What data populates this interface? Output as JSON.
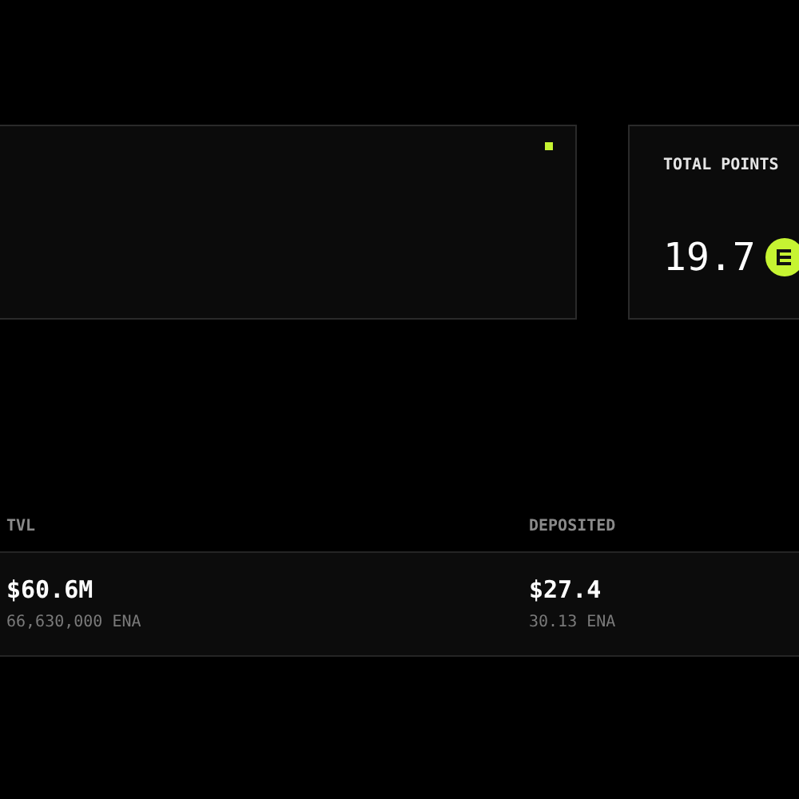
{
  "points_card": {
    "label": "TOTAL POINTS",
    "value": "19.7"
  },
  "table": {
    "columns": [
      "TVL",
      "DEPOSITED"
    ],
    "rows": [
      {
        "cells": [
          {
            "value": "$60.6M",
            "sub": "66,630,000 ENA"
          },
          {
            "value": "$27.4",
            "sub": "30.13 ENA"
          }
        ]
      }
    ]
  }
}
